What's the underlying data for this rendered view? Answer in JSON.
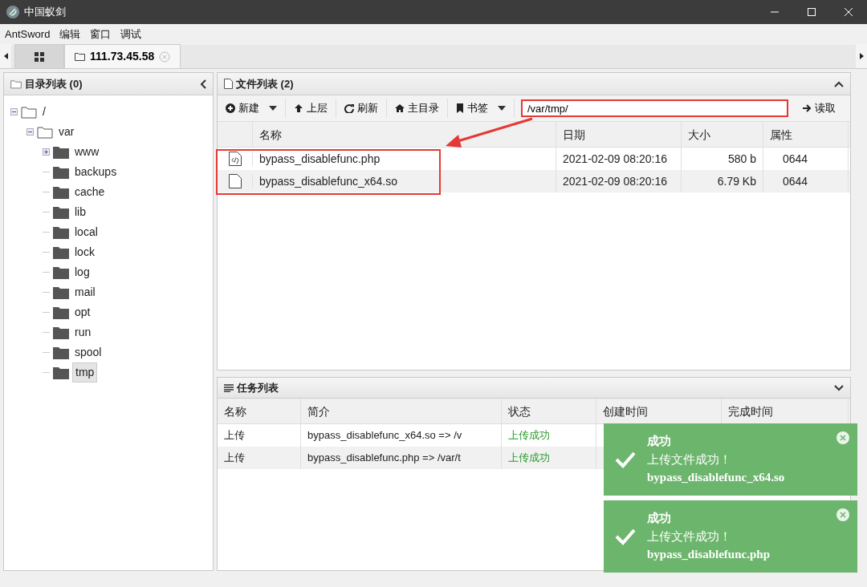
{
  "window": {
    "title": "中国蚁剑"
  },
  "menu": [
    "AntSword",
    "编辑",
    "窗口",
    "调试"
  ],
  "tabs": [
    {
      "kind": "home",
      "selected": false
    },
    {
      "kind": "shell",
      "label": "111.73.45.58",
      "selected": true
    }
  ],
  "dir_panel": {
    "title": "目录列表 (0)",
    "tree": [
      {
        "label": "/",
        "expanded": true,
        "selected": false,
        "children": [
          {
            "label": "var",
            "expanded": true,
            "selected": false,
            "children": [
              {
                "label": "www",
                "expanded": false,
                "selected": false
              },
              {
                "label": "backups",
                "selected": false
              },
              {
                "label": "cache",
                "selected": false
              },
              {
                "label": "lib",
                "selected": false
              },
              {
                "label": "local",
                "selected": false
              },
              {
                "label": "lock",
                "selected": false
              },
              {
                "label": "log",
                "selected": false
              },
              {
                "label": "mail",
                "selected": false
              },
              {
                "label": "opt",
                "selected": false
              },
              {
                "label": "run",
                "selected": false
              },
              {
                "label": "spool",
                "selected": false
              },
              {
                "label": "tmp",
                "selected": true
              }
            ]
          }
        ]
      }
    ]
  },
  "file_panel": {
    "title": "文件列表 (2)",
    "toolbar": [
      {
        "kind": "new",
        "label": "新建",
        "dropdown": true
      },
      {
        "kind": "up",
        "label": "上层",
        "dropdown": false
      },
      {
        "kind": "refresh",
        "label": "刷新",
        "dropdown": false
      },
      {
        "kind": "home",
        "label": "主目录",
        "dropdown": false
      },
      {
        "kind": "bookmark",
        "label": "书签",
        "dropdown": true
      }
    ],
    "path": {
      "value": "/var/tmp/",
      "highlighted": true
    },
    "read_button": "读取",
    "columns": [
      "名称",
      "日期",
      "大小",
      "属性"
    ],
    "rows_highlighted": true,
    "rows": [
      {
        "kind": "code",
        "name": "bypass_disablefunc.php",
        "date": "2021-02-09 08:20:16",
        "size": "580 b",
        "mode": "0644"
      },
      {
        "kind": "file",
        "name": "bypass_disablefunc_x64.so",
        "date": "2021-02-09 08:20:16",
        "size": "6.79 Kb",
        "mode": "0644"
      }
    ]
  },
  "task_panel": {
    "title": "任务列表",
    "columns": [
      "名称",
      "简介",
      "状态",
      "创建时间",
      "完成时间"
    ],
    "rows": [
      {
        "name": "上传",
        "summary": "bypass_disablefunc_x64.so => /v",
        "status": "上传成功"
      },
      {
        "name": "上传",
        "summary": "bypass_disablefunc.php => /var/t",
        "status": "上传成功"
      }
    ]
  },
  "toasts": [
    {
      "title": "成功",
      "message": "上传文件成功！",
      "file": "bypass_disablefunc_x64.so"
    },
    {
      "title": "成功",
      "message": "上传文件成功！",
      "file": "bypass_disablefunc.php"
    }
  ]
}
